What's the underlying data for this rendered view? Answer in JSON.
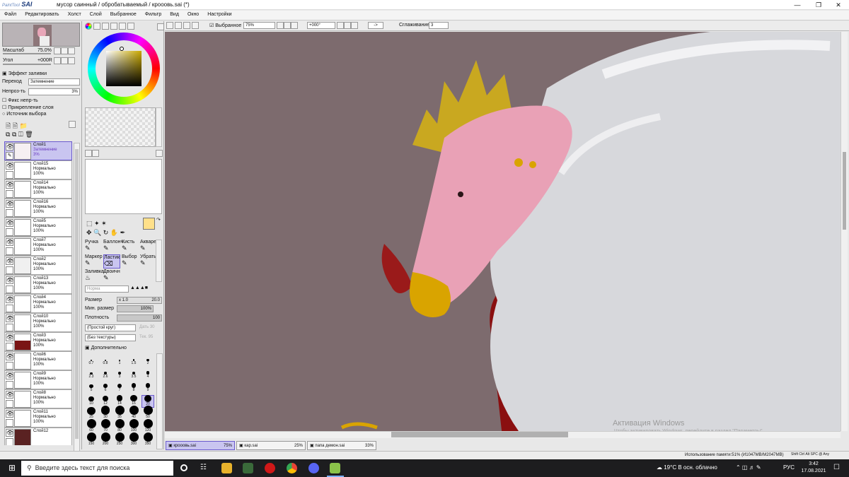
{
  "window": {
    "app_logo": "SAI",
    "app_logo_small": "PaintTool",
    "title": "мусор саинный / обробатываемый / крооовь.sai (*)"
  },
  "menu": [
    "Файл",
    "Редактировать",
    "Холст",
    "Слой",
    "Выбранное",
    "Фильтр",
    "Вид",
    "Окно",
    "Настройки"
  ],
  "navigator": {
    "scale_label": "Масштаб",
    "scale_value": "75.0%",
    "angle_label": "Угол",
    "angle_value": "+000R"
  },
  "fill_effect": {
    "title": "Эффект заливки",
    "blend_label": "Переход",
    "blend_value": "Затемнение",
    "opacity_label": "Непроз-ть",
    "opacity_value": "3%",
    "check_lock_opacity": "Фикс непр-ть",
    "check_clip": "Прикрепление слоя",
    "check_source": "Источник выбора"
  },
  "layers": [
    {
      "name": "Слой1",
      "mode": "Затемнение",
      "opacity": "3%",
      "selected": true
    },
    {
      "name": "Слой15",
      "mode": "Нормально",
      "opacity": "100%"
    },
    {
      "name": "Слой14",
      "mode": "Нормально",
      "opacity": "100%"
    },
    {
      "name": "Слой16",
      "mode": "Нормально",
      "opacity": "100%"
    },
    {
      "name": "Слой5",
      "mode": "Нормально",
      "opacity": "100%"
    },
    {
      "name": "Слой7",
      "mode": "Нормально",
      "opacity": "100%"
    },
    {
      "name": "Слой2",
      "mode": "Нормально",
      "opacity": "100%"
    },
    {
      "name": "Слой13",
      "mode": "Нормально",
      "opacity": "100%"
    },
    {
      "name": "Слой4",
      "mode": "Нормально",
      "opacity": "100%"
    },
    {
      "name": "Слой10",
      "mode": "Нормально",
      "opacity": "100%"
    },
    {
      "name": "Слой3",
      "mode": "Нормально",
      "opacity": "100%"
    },
    {
      "name": "Слой6",
      "mode": "Нормально",
      "opacity": "100%"
    },
    {
      "name": "Слой9",
      "mode": "Нормально",
      "opacity": "100%"
    },
    {
      "name": "Слой8",
      "mode": "Нормально",
      "opacity": "100%"
    },
    {
      "name": "Слой11",
      "mode": "Нормально",
      "opacity": "100%"
    },
    {
      "name": "Слой12",
      "mode": "",
      "opacity": ""
    }
  ],
  "tools": {
    "row1": [
      "Ручка",
      "Баллонч",
      "Кисть",
      "Акварел"
    ],
    "row2": [
      "Маркер",
      "Ластик",
      "Выбор",
      "Убрать"
    ],
    "row3": [
      "Заливка",
      "Двоичн"
    ],
    "mode_value": "Норма",
    "size_label": "Размер",
    "size_mult": "x 1.0",
    "size_value": "20.0",
    "min_size_label": "Мин. размер",
    "min_size_value": "100%",
    "density_label": "Плотность",
    "density_value": "100",
    "shape_value": "(Простой круг)",
    "shape_side": "Дать",
    "shape_side_value": "30",
    "texture_value": "(Без текстуры)",
    "texture_side": "Тек.",
    "texture_side_value": "95",
    "advanced": "Дополнительно",
    "primary_color": "#ffe08a"
  },
  "brush_sizes": [
    "0.7",
    "0.8",
    "1",
    "1.5",
    "2",
    "2.3",
    "2.6",
    "3",
    "3.5",
    "4",
    "5",
    "6",
    "7",
    "8",
    "9",
    "10",
    "12",
    "14",
    "16",
    "20",
    "25",
    "30",
    "35",
    "40",
    "50",
    "60",
    "70",
    "80",
    "100",
    "120",
    "150",
    "200",
    "250",
    "300",
    "350"
  ],
  "toolbar": {
    "selection_check": "Выбранное",
    "zoom_value": "75%",
    "angle_value": "+000°",
    "flip_value": "->",
    "stabilizer_label": "Сглаживание",
    "stabilizer_value": "3"
  },
  "documents": [
    {
      "name": "крооовь.sai",
      "zoom": "75%",
      "active": true
    },
    {
      "name": "кар.sai",
      "zoom": "25%",
      "active": false
    },
    {
      "name": "папа демон.sai",
      "zoom": "33%",
      "active": false
    }
  ],
  "status": {
    "memory": "Использование памяти:51% (И1047MB/М2047MB)",
    "keys": [
      "Shift",
      "Ctrl",
      "Alt",
      "SPC",
      "@",
      "Any"
    ]
  },
  "watermark": {
    "title": "Активация Windows",
    "subtitle": "Чтобы активировать Windows, перейдите в раздел \"Параметры\"."
  },
  "taskbar": {
    "search_placeholder": "Введите здесь текст для поиска",
    "weather": "19°C  В осн. облачно",
    "lang": "РУС",
    "time": "3:42",
    "date": "17.08.2021"
  },
  "colors": {
    "canvas_bg": "#7d6b6e",
    "accent": "#c9c5f0",
    "taskbar": "#1d1d1f"
  }
}
